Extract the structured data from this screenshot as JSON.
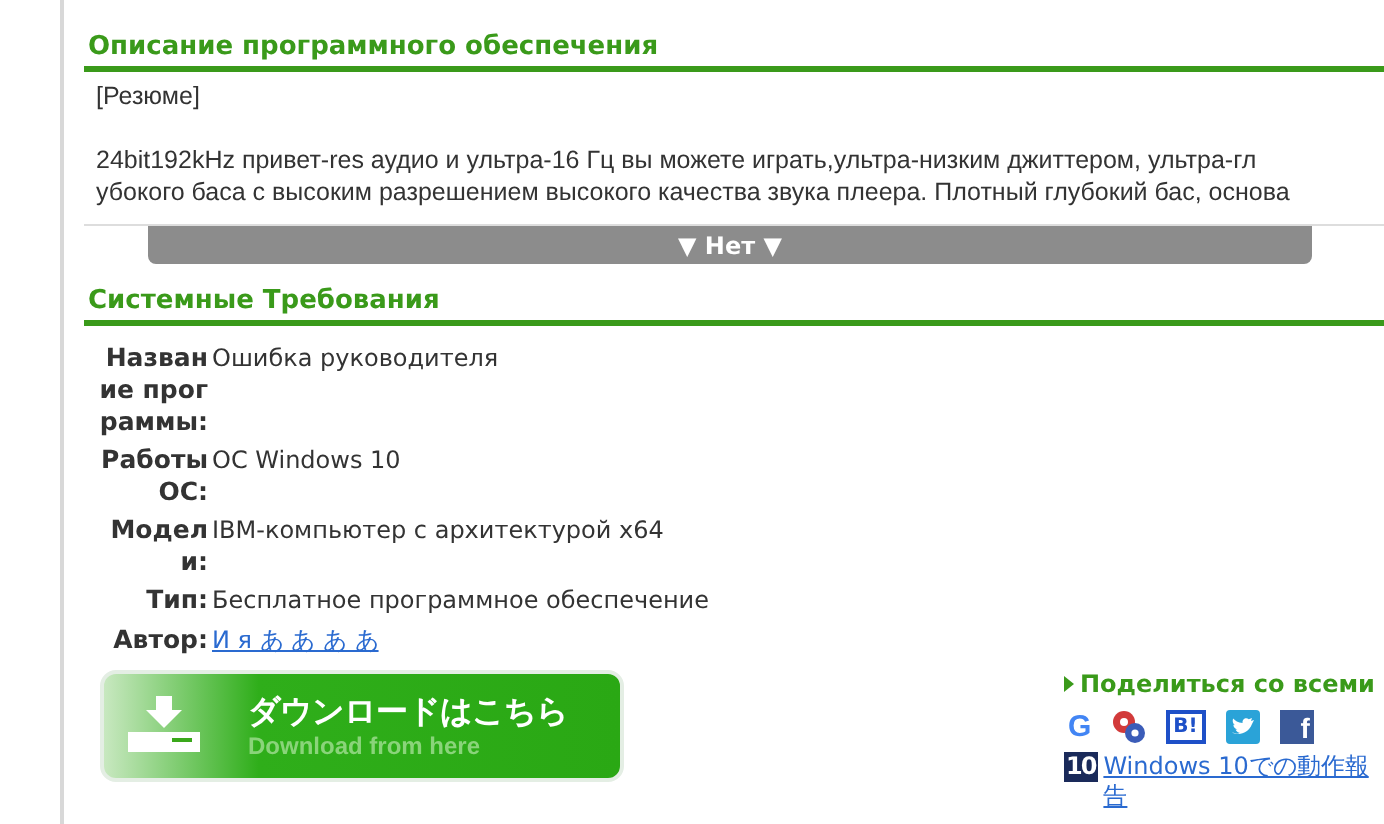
{
  "description": {
    "heading": "Описание программного обеспечения",
    "summary_label": "[Резюме]",
    "lines": [
      "24bit192kHz привет-res аудио и ультра-16 Гц вы можете играть,ультра-низким джиттером, ультра-гл",
      "убокого баса с высоким разрешением высокого качества звука плеера. Плотный глубокий бас, основа"
    ],
    "toggle": "▼ Нет ▼"
  },
  "requirements": {
    "heading": "Системные Требования",
    "rows": [
      {
        "label": "Название программы:",
        "value": "Ошибка руководителя",
        "kind": "text"
      },
      {
        "label": "Работы ОС:",
        "value": "ОС Windows 10",
        "kind": "text"
      },
      {
        "label": "Модели:",
        "value": "IBM-компьютер с архитектурой x64",
        "kind": "text"
      },
      {
        "label": "Тип:",
        "value": "Бесплатное программное обеспечение",
        "kind": "text"
      },
      {
        "label": "Автор:",
        "value": "И я あ あ あ あ",
        "kind": "link"
      }
    ]
  },
  "download": {
    "title": "ダウンロードはこちら",
    "subtitle": "Download from here"
  },
  "share": {
    "heading": "Поделиться со всеми",
    "icons": [
      {
        "kind": "letter",
        "text": "G"
      },
      {
        "kind": "dots"
      },
      {
        "kind": "boxed",
        "text": "B!"
      },
      {
        "kind": "bird"
      },
      {
        "kind": "tile",
        "text": "f"
      }
    ],
    "report": {
      "badge": "10",
      "link": "Windows 10での動作報告"
    }
  }
}
